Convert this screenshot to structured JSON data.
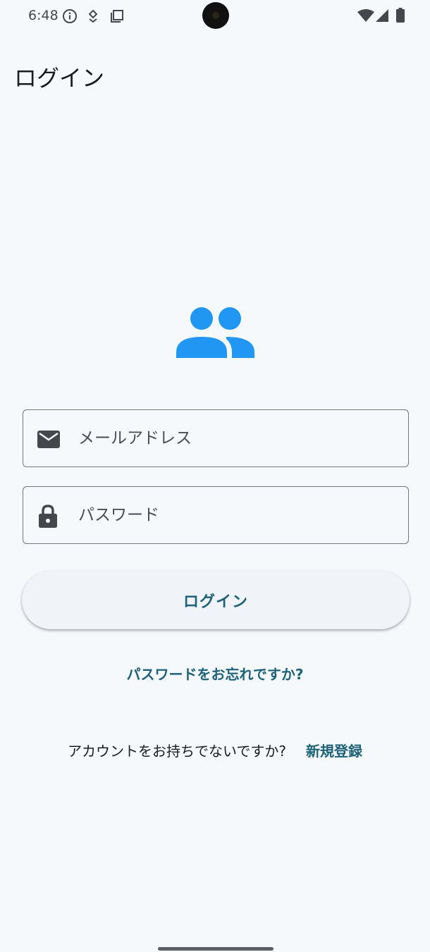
{
  "status_bar": {
    "time": "6:48",
    "left_icons": [
      "info-icon",
      "location-pin-icon",
      "screen-copy-icon"
    ],
    "right_icons": [
      "wifi-icon",
      "cell-signal-icon",
      "battery-icon"
    ]
  },
  "header": {
    "title": "ログイン"
  },
  "hero": {
    "icon": "group-icon",
    "color": "#2196f3"
  },
  "form": {
    "email": {
      "placeholder": "メールアドレス",
      "value": "",
      "icon": "mail-icon"
    },
    "password": {
      "placeholder": "パスワード",
      "value": "",
      "icon": "lock-icon"
    },
    "login_label": "ログイン",
    "forgot_label": "パスワードをお忘れですか?"
  },
  "signup": {
    "prompt": "アカウントをお持ちでないですか?",
    "link_label": "新規登録"
  },
  "colors": {
    "background": "#f5f9fc",
    "accent": "#1e6279",
    "icon_blue": "#2196f3"
  }
}
